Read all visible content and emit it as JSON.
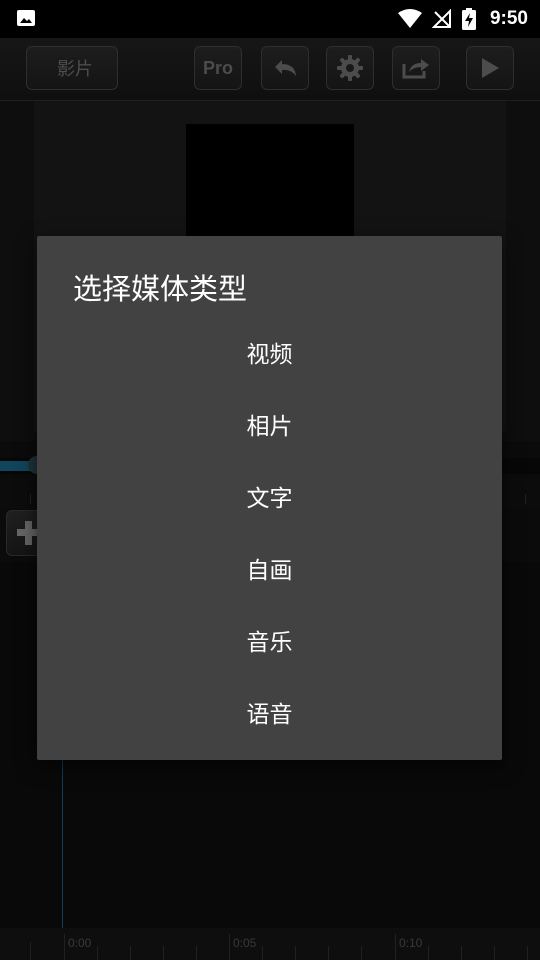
{
  "status_bar": {
    "time": "9:50",
    "icons": [
      "image-icon",
      "wifi-icon",
      "no-signal-icon",
      "battery-charging-icon"
    ]
  },
  "toolbar": {
    "back_label": "影片",
    "pro_label": "Pro",
    "icons": [
      "undo-icon",
      "gear-icon",
      "share-icon",
      "play-icon"
    ]
  },
  "timeline": {
    "add_icon": "plus-icon",
    "ruler_labels": [
      "0:00",
      "0:05",
      "0:10"
    ]
  },
  "dialog": {
    "title": "选择媒体类型",
    "options": [
      "视频",
      "相片",
      "文字",
      "自画",
      "音乐",
      "语音"
    ]
  },
  "colors": {
    "dialog_bg": "#424242",
    "accent": "#1e7ea8"
  }
}
